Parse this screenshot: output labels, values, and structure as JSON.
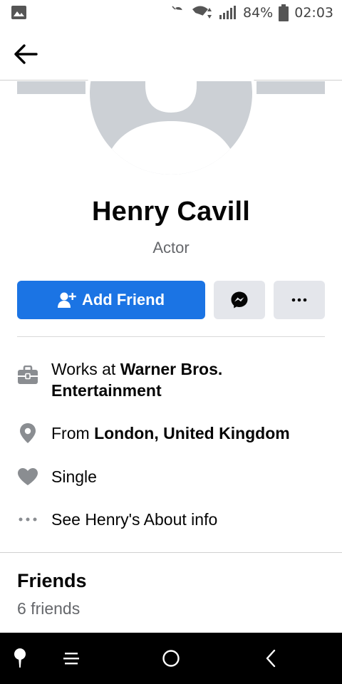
{
  "status_bar": {
    "battery_percent": "84%",
    "time": "02:03"
  },
  "profile": {
    "name": "Henry Cavill",
    "subtitle": "Actor"
  },
  "actions": {
    "add_friend_label": "Add Friend"
  },
  "info": {
    "work_prefix": "Works at ",
    "work_place": "Warner Bros. Entertainment",
    "location_prefix": "From ",
    "location": "London, United Kingdom",
    "relationship": "Single",
    "about_link": "See Henry's About info"
  },
  "friends": {
    "title": "Friends",
    "count": "6 friends"
  },
  "colors": {
    "accent": "#1b74e4",
    "secondary_button": "#e4e6eb",
    "muted_text": "#65676b",
    "icon_gray": "#8a8d91"
  },
  "icons": {
    "status": [
      "gallery-icon",
      "notifications-off-icon",
      "wifi-icon",
      "signal-icon",
      "battery-icon"
    ],
    "nav": [
      "back-arrow-icon"
    ],
    "actions": [
      "add-friend-icon",
      "messenger-icon",
      "more-icon"
    ],
    "info": [
      "briefcase-icon",
      "location-pin-icon",
      "heart-icon",
      "dots-icon"
    ],
    "system_nav": [
      "assistant-icon",
      "menu-icon",
      "home-icon",
      "back-icon"
    ]
  }
}
